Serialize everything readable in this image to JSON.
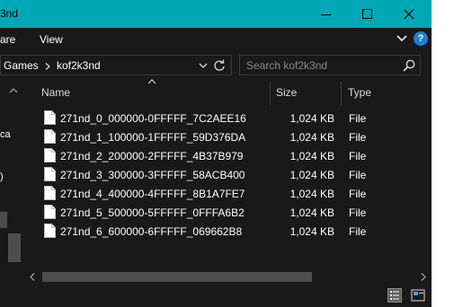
{
  "window": {
    "title_fragment": "3nd",
    "accent_color": "#00a8b5",
    "buttons": [
      "minimize",
      "maximize",
      "close"
    ]
  },
  "ribbon": {
    "tabs": [
      "are",
      "View"
    ],
    "help_label": "?"
  },
  "address": {
    "crumbs": [
      "Games",
      "kof2k3nd"
    ],
    "search_placeholder": "Search kof2k3nd"
  },
  "navpane": {
    "items": [
      "ca",
      ")"
    ]
  },
  "columns": {
    "name": "Name",
    "size": "Size",
    "type": "Type"
  },
  "files": [
    {
      "name": "271nd_0_000000-0FFFFF_7C2AEE16",
      "size": "1,024 KB",
      "type": "File"
    },
    {
      "name": "271nd_1_100000-1FFFFF_59D376DA",
      "size": "1,024 KB",
      "type": "File"
    },
    {
      "name": "271nd_2_200000-2FFFFF_4B37B979",
      "size": "1,024 KB",
      "type": "File"
    },
    {
      "name": "271nd_3_300000-3FFFFF_58ACB400",
      "size": "1,024 KB",
      "type": "File"
    },
    {
      "name": "271nd_4_400000-4FFFFF_8B1A7FE7",
      "size": "1,024 KB",
      "type": "File"
    },
    {
      "name": "271nd_5_500000-5FFFFF_0FFFA6B2",
      "size": "1,024 KB",
      "type": "File"
    },
    {
      "name": "271nd_6_600000-6FFFFF_069662B8",
      "size": "1,024 KB",
      "type": "File"
    }
  ],
  "icons": {
    "file": "file-icon",
    "search": "search-icon",
    "refresh": "refresh-icon",
    "details_view": "details-view-icon",
    "tiles_view": "tiles-view-icon"
  }
}
